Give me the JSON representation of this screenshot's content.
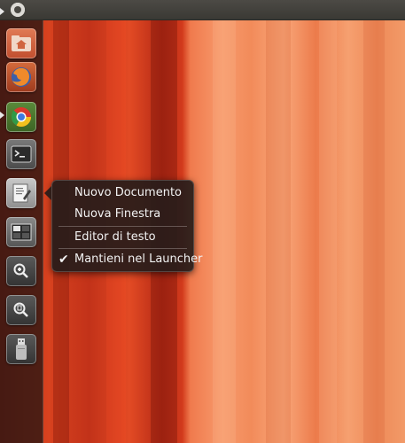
{
  "top_panel": {
    "logo_icon": "ubuntu-logo-icon"
  },
  "launcher": {
    "items": [
      {
        "name": "home-folder",
        "icon": "home-folder-icon",
        "running": true
      },
      {
        "name": "firefox",
        "icon": "firefox-icon",
        "running": false
      },
      {
        "name": "chrome",
        "icon": "chrome-icon",
        "running": true
      },
      {
        "name": "terminal",
        "icon": "terminal-icon",
        "running": false
      },
      {
        "name": "text-editor",
        "icon": "text-editor-icon",
        "running": false
      },
      {
        "name": "workspace-switcher",
        "icon": "workspace-switcher-icon",
        "running": false
      },
      {
        "name": "lens-apps",
        "icon": "magnifier-apps-icon",
        "running": false
      },
      {
        "name": "lens-files",
        "icon": "magnifier-files-icon",
        "running": false
      },
      {
        "name": "usb-drive",
        "icon": "usb-drive-icon",
        "running": false
      }
    ]
  },
  "quicklist": {
    "items": [
      {
        "label": "Nuovo Documento"
      },
      {
        "label": "Nuova Finestra"
      },
      {
        "label": "Editor di testo"
      },
      {
        "label": "Mantieni nel Launcher",
        "checked": true
      }
    ],
    "check_glyph": "✔"
  }
}
